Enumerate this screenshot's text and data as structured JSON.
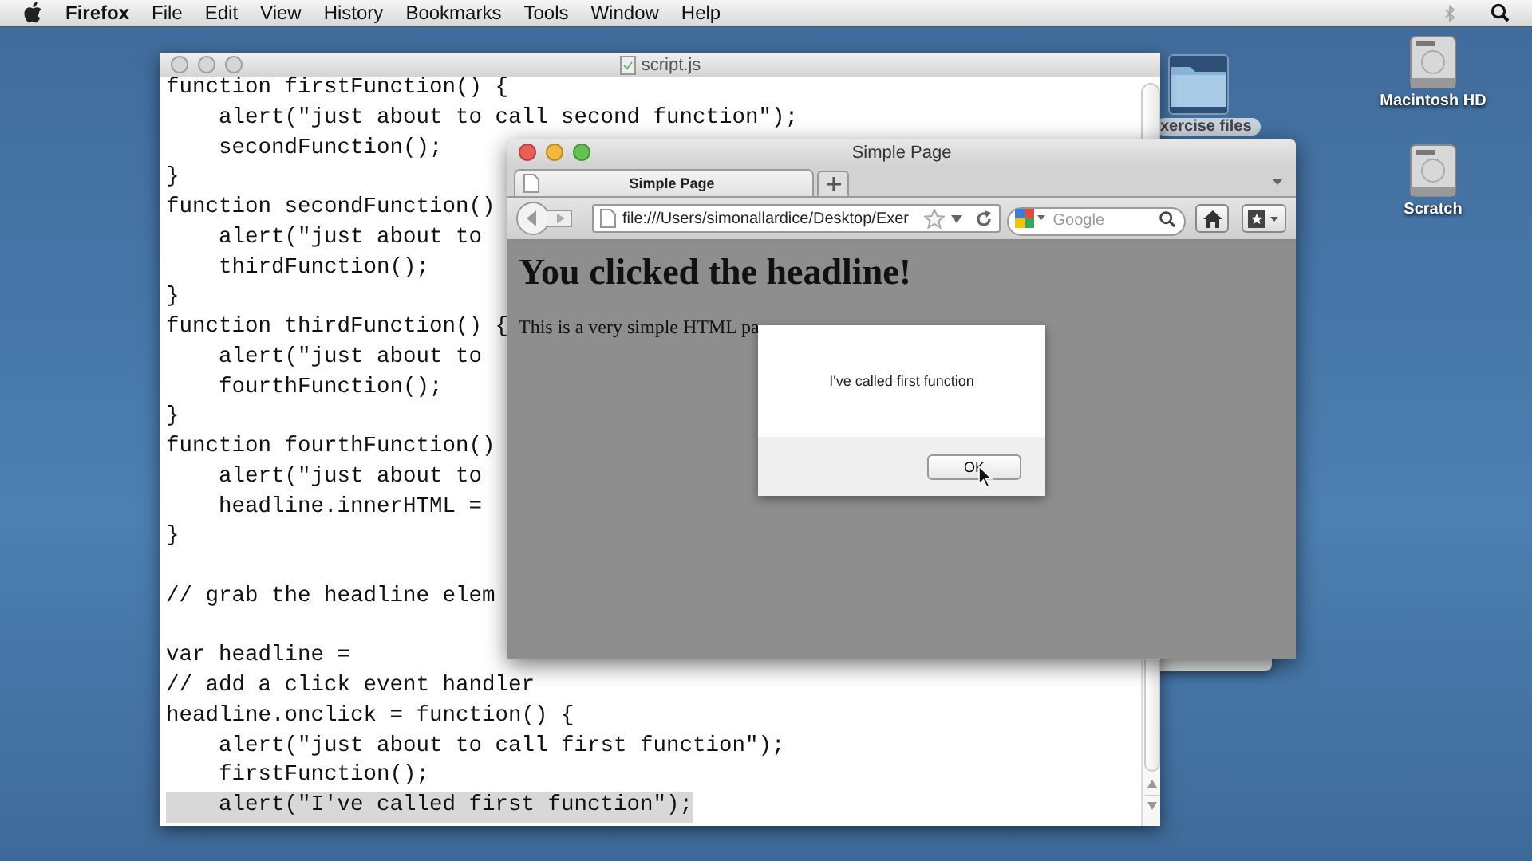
{
  "menubar": {
    "app_name": "Firefox",
    "menus": [
      "File",
      "Edit",
      "View",
      "History",
      "Bookmarks",
      "Tools",
      "Window",
      "Help"
    ]
  },
  "desktop": {
    "folder": {
      "label": "xercise files"
    },
    "drives": [
      {
        "label": "Macintosh HD"
      },
      {
        "label": "Scratch"
      }
    ]
  },
  "editor": {
    "title": "script.js",
    "active": false,
    "lines": [
      {
        "text": "function firstFunction() {",
        "highlighted": false
      },
      {
        "text": "    alert(\"just about to call second function\");",
        "highlighted": false
      },
      {
        "text": "    secondFunction();",
        "highlighted": false
      },
      {
        "text": "}",
        "highlighted": false
      },
      {
        "text": "function secondFunction()",
        "highlighted": false
      },
      {
        "text": "    alert(\"just about to",
        "highlighted": false
      },
      {
        "text": "    thirdFunction();",
        "highlighted": false
      },
      {
        "text": "}",
        "highlighted": false
      },
      {
        "text": "function thirdFunction() {",
        "highlighted": false
      },
      {
        "text": "    alert(\"just about to",
        "highlighted": false
      },
      {
        "text": "    fourthFunction();",
        "highlighted": false
      },
      {
        "text": "}",
        "highlighted": false
      },
      {
        "text": "function fourthFunction()",
        "highlighted": false
      },
      {
        "text": "    alert(\"just about to",
        "highlighted": false
      },
      {
        "text": "    headline.innerHTML =",
        "highlighted": false
      },
      {
        "text": "}",
        "highlighted": false
      },
      {
        "highlighted": false
      },
      {
        "text": "// grab the headline elem",
        "highlighted": false
      },
      {
        "highlighted": false
      },
      {
        "text": "var headline =",
        "highlighted": false
      },
      {
        "text": "// add a click event handler",
        "highlighted": false
      },
      {
        "text": "headline.onclick = function() {",
        "highlighted": false
      },
      {
        "text": "    alert(\"just about to call first function\");",
        "highlighted": false
      },
      {
        "text": "    firstFunction();",
        "highlighted": false
      },
      {
        "text": "    alert(\"I've called first function\");",
        "highlighted": true
      }
    ]
  },
  "browser": {
    "title": "Simple Page",
    "active": true,
    "tabs": [
      {
        "label": "Simple Page",
        "selected": true
      }
    ],
    "url": "file:///Users/simonallardice/Desktop/Exer",
    "search_placeholder": "Google",
    "page": {
      "heading": "You clicked the headline!",
      "paragraph": "This is a very simple HTML pa"
    },
    "dialog": {
      "message": "I've called first function",
      "button": "OK"
    }
  }
}
